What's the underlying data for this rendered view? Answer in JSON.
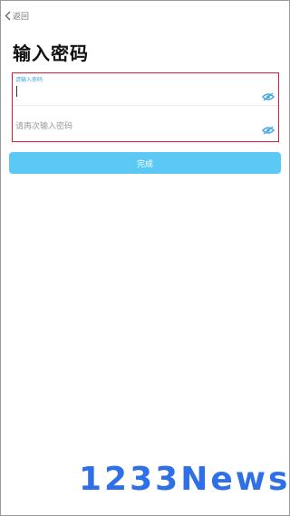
{
  "nav": {
    "back_label": "返回"
  },
  "page": {
    "title": "输入密码"
  },
  "form": {
    "password": {
      "floating_label": "请输入密码",
      "value": ""
    },
    "confirm": {
      "placeholder": "请再次输入密码",
      "value": ""
    }
  },
  "submit_label": "完成",
  "watermark_text": "1233News",
  "colors": {
    "accent": "#3ea7e0",
    "button": "#5cc9f5",
    "highlight_border": "#d0203a",
    "watermark": "#2f6fe8"
  }
}
